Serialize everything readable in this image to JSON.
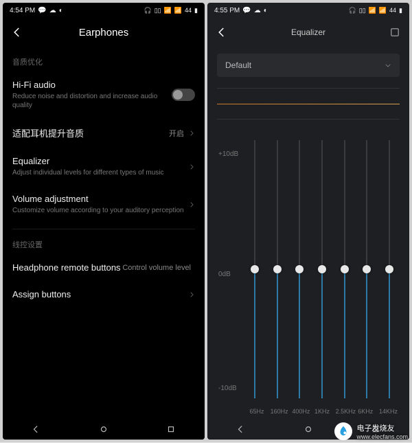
{
  "left": {
    "status": {
      "time": "4:54 PM",
      "battery": "44"
    },
    "header": {
      "title": "Earphones"
    },
    "sections": {
      "audio_label": "音质优化",
      "hifi": {
        "title": "Hi-Fi audio",
        "sub": "Reduce noise and distortion and increase audio quality",
        "on": false
      },
      "match": {
        "title": "适配耳机提升音质",
        "value": "开启"
      },
      "eq": {
        "title": "Equalizer",
        "sub": "Adjust individual levels for different types of music"
      },
      "vol": {
        "title": "Volume adjustment",
        "sub": "Customize volume according to your auditory perception"
      },
      "wire_label": "线控设置",
      "remote": {
        "title": "Headphone remote buttons",
        "value": "Control volume level"
      },
      "assign": {
        "title": "Assign buttons"
      }
    }
  },
  "right": {
    "status": {
      "time": "4:55 PM",
      "battery": "44"
    },
    "header": {
      "title": "Equalizer"
    },
    "preset": "Default",
    "scale": {
      "top": "+10dB",
      "mid": "0dB",
      "bot": "-10dB"
    }
  },
  "chart_data": {
    "type": "bar",
    "title": "Equalizer",
    "ylabel": "dB",
    "ylim": [
      -10,
      10
    ],
    "categories": [
      "65Hz",
      "160Hz",
      "400Hz",
      "1KHz",
      "2.5KHz",
      "6KHz",
      "14KHz"
    ],
    "values": [
      0,
      0,
      0,
      0,
      0,
      0,
      0
    ]
  },
  "watermark": {
    "brand": "电子发烧友",
    "url": "www.elecfans.com"
  }
}
